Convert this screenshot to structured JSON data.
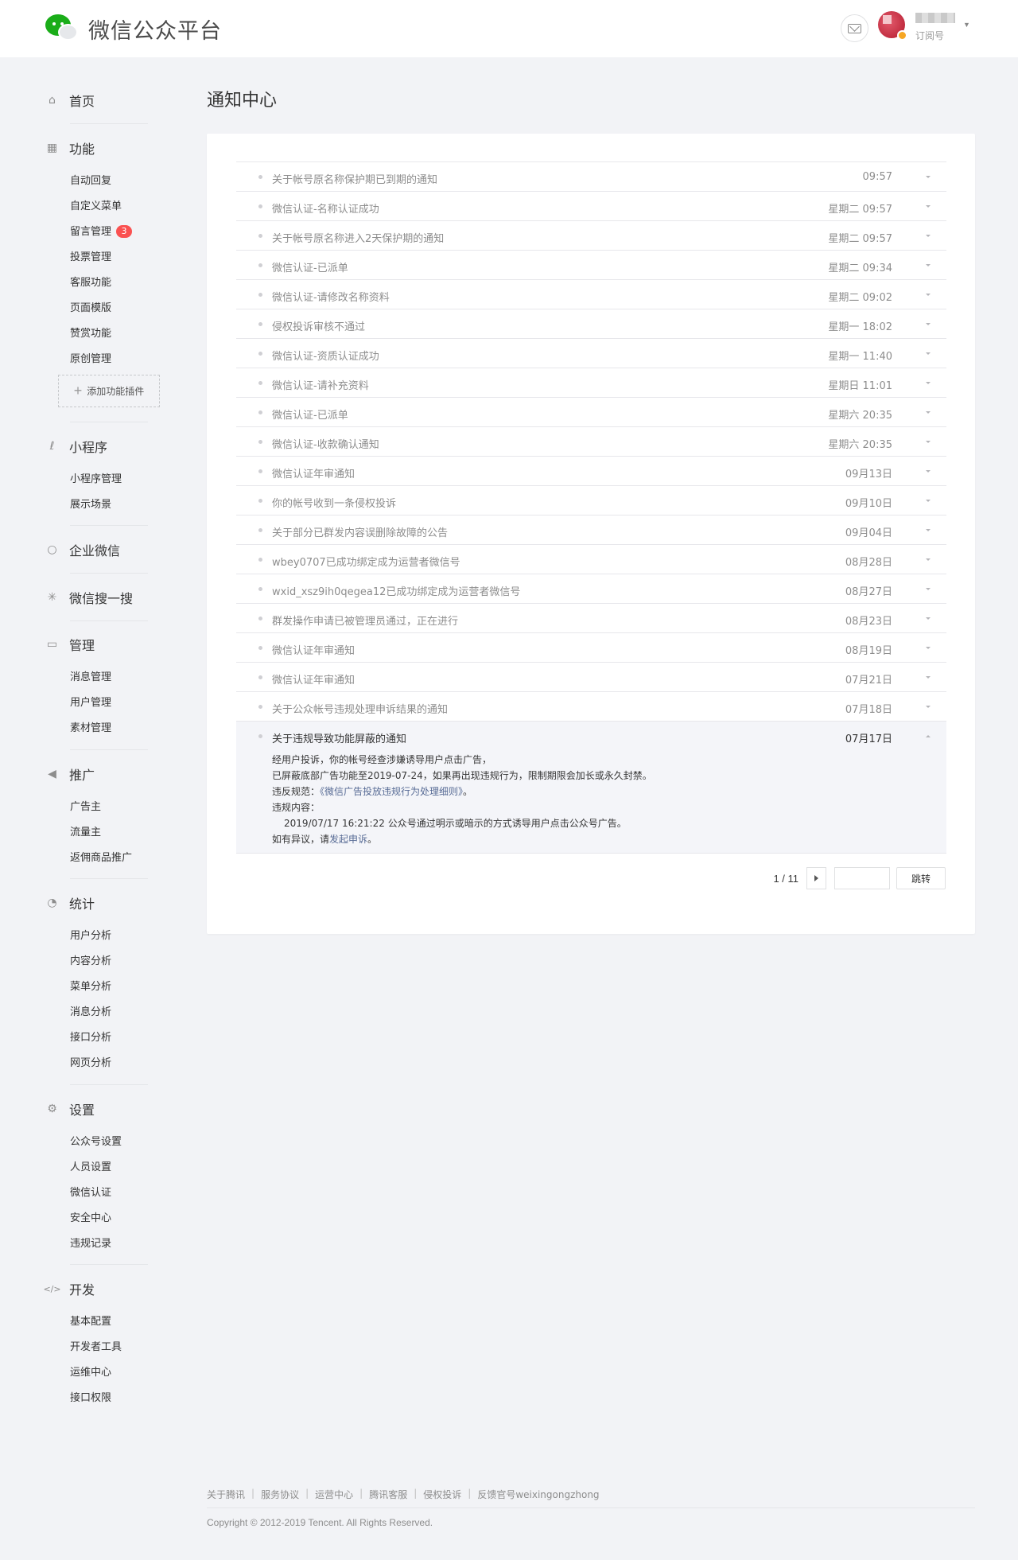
{
  "header": {
    "logo_text": "微信公众平台",
    "account_type": "订阅号"
  },
  "sidebar": {
    "home": "首页",
    "function": {
      "title": "功能",
      "items": [
        "自动回复",
        "自定义菜单",
        "留言管理",
        "投票管理",
        "客服功能",
        "页面模版",
        "赞赏功能",
        "原创管理"
      ],
      "message_badge": "3",
      "add_plugin": "添加功能插件"
    },
    "miniprogram": {
      "title": "小程序",
      "items": [
        "小程序管理",
        "展示场景"
      ]
    },
    "wecom": "企业微信",
    "search": "微信搜一搜",
    "manage": {
      "title": "管理",
      "items": [
        "消息管理",
        "用户管理",
        "素材管理"
      ]
    },
    "promote": {
      "title": "推广",
      "items": [
        "广告主",
        "流量主",
        "返佣商品推广"
      ]
    },
    "stats": {
      "title": "统计",
      "items": [
        "用户分析",
        "内容分析",
        "菜单分析",
        "消息分析",
        "接口分析",
        "网页分析"
      ]
    },
    "settings": {
      "title": "设置",
      "items": [
        "公众号设置",
        "人员设置",
        "微信认证",
        "安全中心",
        "违规记录"
      ]
    },
    "dev": {
      "title": "开发",
      "items": [
        "基本配置",
        "开发者工具",
        "运维中心",
        "接口权限"
      ]
    }
  },
  "main": {
    "title": "通知中心",
    "notices": [
      {
        "title": "关于帐号原名称保护期已到期的通知",
        "time": "09:57"
      },
      {
        "title": "微信认证-名称认证成功",
        "time": "星期二 09:57"
      },
      {
        "title": "关于帐号原名称进入2天保护期的通知",
        "time": "星期二 09:57"
      },
      {
        "title": "微信认证-已派单",
        "time": "星期二 09:34"
      },
      {
        "title": "微信认证-请修改名称资料",
        "time": "星期二 09:02"
      },
      {
        "title": "侵权投诉审核不通过",
        "time": "星期一 18:02"
      },
      {
        "title": "微信认证-资质认证成功",
        "time": "星期一 11:40"
      },
      {
        "title": "微信认证-请补充资料",
        "time": "星期日 11:01"
      },
      {
        "title": "微信认证-已派单",
        "time": "星期六 20:35"
      },
      {
        "title": "微信认证-收款确认通知",
        "time": "星期六 20:35"
      },
      {
        "title": "微信认证年审通知",
        "time": "09月13日"
      },
      {
        "title": "你的帐号收到一条侵权投诉",
        "time": "09月10日"
      },
      {
        "title": "关于部分已群发内容误删除故障的公告",
        "time": "09月04日"
      },
      {
        "title": "wbey0707已成功绑定成为运营者微信号",
        "time": "08月28日"
      },
      {
        "title": "wxid_xsz9ih0qegea12已成功绑定成为运营者微信号",
        "time": "08月27日"
      },
      {
        "title": "群发操作申请已被管理员通过，正在进行",
        "time": "08月23日"
      },
      {
        "title": "微信认证年审通知",
        "time": "08月19日"
      },
      {
        "title": "微信认证年审通知",
        "time": "07月21日"
      },
      {
        "title": "关于公众帐号违规处理申诉结果的通知",
        "time": "07月18日"
      }
    ],
    "open_notice": {
      "title": "关于违规导致功能屏蔽的通知",
      "time": "07月17日",
      "line1": "经用户投诉，你的帐号经查涉嫌诱导用户点击广告，",
      "line2": "已屏蔽底部广告功能至2019-07-24，如果再出现违规行为，限制期限会加长或永久封禁。",
      "rule_prefix": "违反规范：",
      "rule_link": "《微信广告投放违规行为处理细则》",
      "rule_suffix": "。",
      "content_label": "违规内容：",
      "content": "2019/07/17 16:21:22 公众号通过明示或暗示的方式诱导用户点击公众号广告。",
      "appeal_prefix": "如有异议，请",
      "appeal_link": "发起申诉",
      "appeal_suffix": "。"
    },
    "pager": {
      "label": "1 / 11",
      "go": "跳转"
    }
  },
  "footer": {
    "links": [
      "关于腾讯",
      "服务协议",
      "运营中心",
      "腾讯客服",
      "侵权投诉",
      "反馈官号weixingongzhong"
    ],
    "copyright": "Copyright © 2012-2019 Tencent. All Rights Reserved."
  }
}
